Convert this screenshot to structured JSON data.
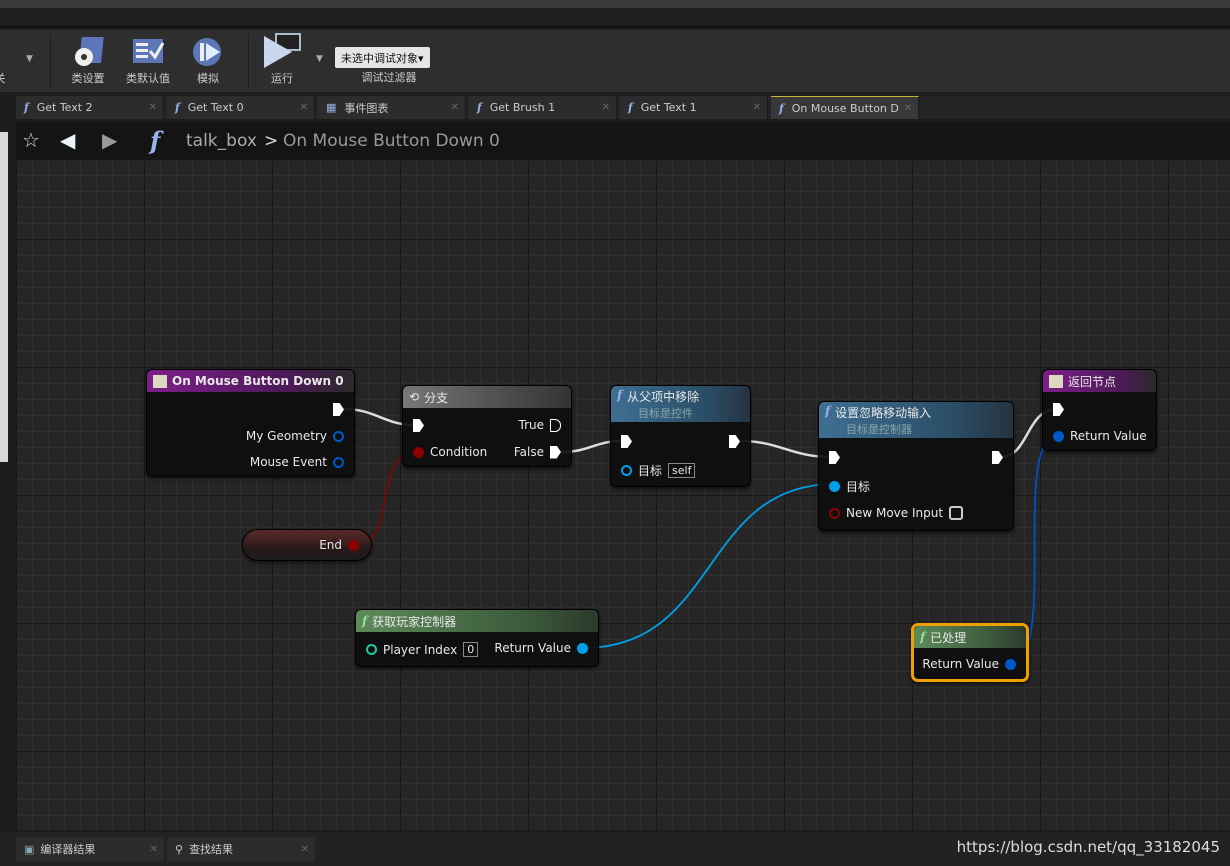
{
  "toolbar": {
    "cut_label": "关",
    "buttons": [
      {
        "label": "类设置",
        "icon": "class-settings-icon"
      },
      {
        "label": "类默认值",
        "icon": "class-defaults-icon"
      },
      {
        "label": "模拟",
        "icon": "simulate-icon"
      },
      {
        "label": "运行",
        "icon": "play-icon"
      }
    ],
    "debug_select": "未选中调试对象▾",
    "debug_filter_label": "调试过滤器"
  },
  "tabs": [
    {
      "label": "Get Text 2",
      "icon": "function-icon"
    },
    {
      "label": "Get Text 0",
      "icon": "function-icon"
    },
    {
      "label": "事件图表",
      "icon": "event-graph-icon"
    },
    {
      "label": "Get Brush 1",
      "icon": "function-icon"
    },
    {
      "label": "Get Text 1",
      "icon": "function-icon"
    },
    {
      "label": "On Mouse Button D",
      "icon": "function-icon",
      "active": true
    }
  ],
  "breadcrumb": {
    "root": "talk_box",
    "separator": ">",
    "current": "On Mouse Button Down 0"
  },
  "nodes": {
    "entry": {
      "title": "On Mouse Button Down 0",
      "pins": [
        "My Geometry",
        "Mouse Event"
      ]
    },
    "branch": {
      "title": "分支",
      "condition": "Condition",
      "true": "True",
      "false": "False"
    },
    "end": {
      "label": "End"
    },
    "remove": {
      "title": "从父项中移除",
      "subtitle": "目标是控件",
      "target": "目标",
      "target_value": "self"
    },
    "ignore": {
      "title": "设置忽略移动输入",
      "subtitle": "目标是控制器",
      "target": "目标",
      "new_move": "New Move Input",
      "new_move_checked": false
    },
    "return": {
      "title": "返回节点",
      "return_value": "Return Value"
    },
    "getpc": {
      "title": "获取玩家控制器",
      "player_index": "Player Index",
      "player_index_value": "0",
      "return_value": "Return Value"
    },
    "handled": {
      "title": "已处理",
      "return_value": "Return Value"
    }
  },
  "colors": {
    "exec": "#ffffff",
    "bool": "#8c0000",
    "object": "#00a8f0",
    "struct": "#0057c8",
    "selected": "#f0a000"
  },
  "bottom": {
    "tabs": [
      {
        "label": "编译器结果"
      },
      {
        "label": "查找结果"
      }
    ],
    "watermark": "https://blog.csdn.net/qq_33182045"
  }
}
